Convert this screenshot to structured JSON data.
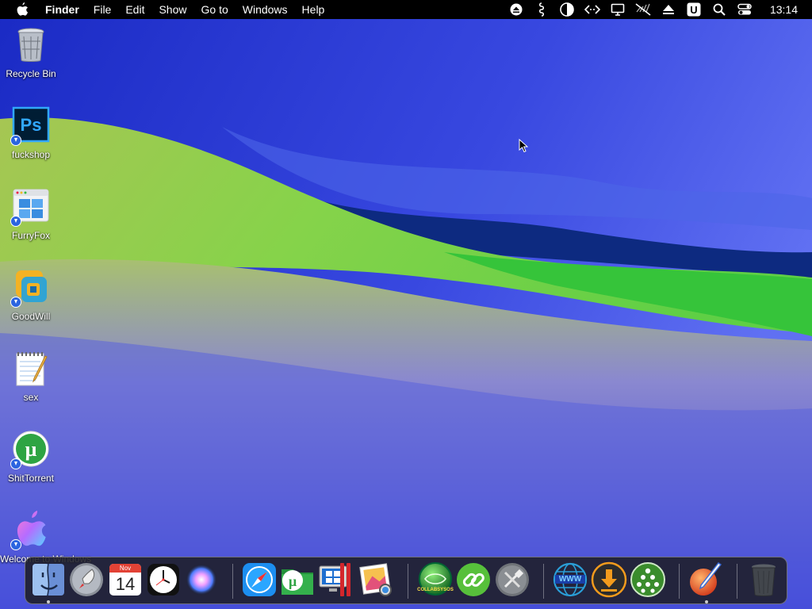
{
  "menubar": {
    "apple_icon": "apple-logo-icon",
    "items": [
      "Finder",
      "File",
      "Edit",
      "Show",
      "Go to",
      "Windows",
      "Help"
    ],
    "status_icons": [
      "mount-icon",
      "script-icon",
      "appearance-icon",
      "code-icon",
      "display-icon",
      "mute-icon",
      "eject-icon",
      "u-icon",
      "search-icon",
      "control-center-icon"
    ],
    "clock": "13:14"
  },
  "desktop": {
    "icons": [
      {
        "label": "Recycle Bin",
        "icon": "trash-can-icon"
      },
      {
        "label": "fuckshop",
        "icon": "photoshop-icon"
      },
      {
        "label": "FurryFox",
        "icon": "browser-window-icon"
      },
      {
        "label": "GoodWill",
        "icon": "vmware-icon"
      },
      {
        "label": "sex",
        "icon": "notepad-icon"
      },
      {
        "label": "ShitTorrent",
        "icon": "utorrent-icon"
      },
      {
        "label": "Welcome to Windows",
        "icon": "apple-colorful-icon"
      }
    ]
  },
  "dock": {
    "calendar_month": "Nov",
    "calendar_day": "14",
    "collab_label": "COLLABSYSOS",
    "www_label": "WWW",
    "items": [
      "finder-icon",
      "launchpad-icon",
      "calendar-icon",
      "clock-icon",
      "siri-icon",
      "safari-icon",
      "utorrent-folder-icon",
      "parallels-icon",
      "preview-icon",
      "collabsysos-icon",
      "link-icon",
      "tools-icon",
      "globe-icon",
      "download-icon",
      "network-icon",
      "pen-app-icon",
      "trash-icon"
    ]
  },
  "colors": {
    "sky": "#2a3ed0",
    "hill_green": "#7fd24a",
    "dark_band": "#0d2a80",
    "bright_green": "#3cc53c"
  }
}
